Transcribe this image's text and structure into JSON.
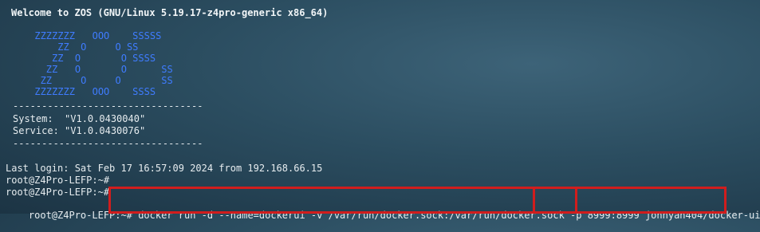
{
  "terminal": {
    "welcome": "Welcome to ZOS (GNU/Linux 5.19.17-z4pro-generic x86_64)",
    "logo_lines": [
      "      ZZZZZZZ   OOO    SSSSS",
      "          ZZ  O     O SS",
      "         ZZ  O       O SSSS",
      "        ZZ   O       O      SS",
      "       ZZ     O     O       SS",
      "      ZZZZZZZ   OOO    SSSS"
    ],
    "divider_top": "---------------------------------",
    "system_line": "System:  \"V1.0.0430040\"",
    "service_line": "Service: \"V1.0.0430076\"",
    "divider_bottom": "---------------------------------",
    "last_login": "Last login: Sat Feb 17 16:57:09 2024 from 192.168.66.15",
    "prompt_1": "root@Z4Pro-LEFP:~#",
    "prompt_2": "root@Z4Pro-LEFP:~#",
    "prompt_3": "root@Z4Pro-LEFP:~#",
    "command": "docker run -d --name=dockerui -v /var/run/docker.sock:/var/run/docker.sock -p 8999:8999 jonnyan404/docker-ui",
    "highlight_color": "#d11d1d",
    "logo_color": "#3f7cff"
  }
}
